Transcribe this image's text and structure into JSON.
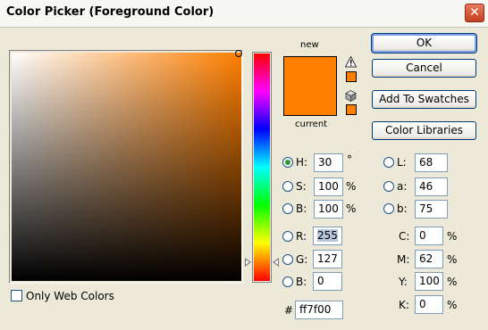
{
  "window": {
    "title": "Color Picker (Foreground Color)",
    "close_glyph": "✕"
  },
  "preview": {
    "new_label": "new",
    "current_label": "current",
    "new_color": "#ff7f00",
    "current_color": "#ff7f00"
  },
  "buttons": {
    "ok": "OK",
    "cancel": "Cancel",
    "add_to_swatches": "Add To Swatches",
    "color_libraries": "Color Libraries"
  },
  "hsb": [
    {
      "label": "H:",
      "value": "30",
      "unit": "°",
      "selected": true
    },
    {
      "label": "S:",
      "value": "100",
      "unit": "%",
      "selected": false
    },
    {
      "label": "B:",
      "value": "100",
      "unit": "%",
      "selected": false
    }
  ],
  "rgb": [
    {
      "label": "R:",
      "value": "255"
    },
    {
      "label": "G:",
      "value": "127"
    },
    {
      "label": "B:",
      "value": "0"
    }
  ],
  "lab": [
    {
      "label": "L:",
      "value": "68"
    },
    {
      "label": "a:",
      "value": "46"
    },
    {
      "label": "b:",
      "value": "75"
    }
  ],
  "cmyk": [
    {
      "label": "C:",
      "value": "0",
      "unit": "%"
    },
    {
      "label": "M:",
      "value": "62",
      "unit": "%"
    },
    {
      "label": "Y:",
      "value": "100",
      "unit": "%"
    },
    {
      "label": "K:",
      "value": "0",
      "unit": "%"
    }
  ],
  "hex": {
    "label": "#",
    "value": "ff7f00"
  },
  "web_colors": {
    "label": "Only Web Colors",
    "checked": false
  },
  "icons": {
    "gamut_warning": "warning-triangle-icon",
    "web_safe": "cube-icon"
  }
}
